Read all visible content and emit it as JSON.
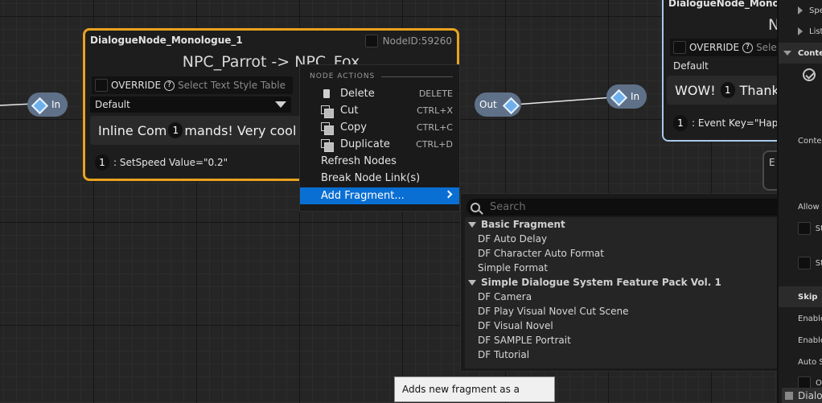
{
  "graph": {
    "left_pin_label": "In",
    "out_pin_label": "Out",
    "right_pin_label": "In"
  },
  "node1": {
    "title": "DialogueNode_Monologue_1",
    "node_id": "NodeID:59260",
    "speaker": "NPC_Parrot -> NPC_Fox",
    "override_label": "OVERRIDE",
    "style_placeholder": "Select Text Style Table",
    "style_value": "Default",
    "text_part1": "Inline Com",
    "text_badge": "1",
    "text_part2": "mands! Very cool fea",
    "event_badge": "1",
    "event_text": ": SetSpeed Value=\"0.2\""
  },
  "node2": {
    "title": "DialogueNode_Monologue",
    "speaker_fragment": "N",
    "override_label": "OVERRIDE",
    "style_placeholder": "Sele",
    "style_value": "Default",
    "text_part1": "WOW!",
    "text_badge": "1",
    "text_part2": "Thank",
    "event_badge": "1",
    "event_text": ": Event Key=\"Happ"
  },
  "node3": {
    "title_fragment": "E"
  },
  "context_menu": {
    "section_label": "NODE ACTIONS",
    "items": [
      {
        "label": "Delete",
        "shortcut": "DELETE",
        "icon": "trash-icon"
      },
      {
        "label": "Cut",
        "shortcut": "CTRL+X",
        "icon": "cut-icon"
      },
      {
        "label": "Copy",
        "shortcut": "CTRL+C",
        "icon": "copy-icon"
      },
      {
        "label": "Duplicate",
        "shortcut": "CTRL+D",
        "icon": "duplicate-icon"
      },
      {
        "label": "Refresh Nodes"
      },
      {
        "label": "Break Node Link(s)"
      },
      {
        "label": "Add Fragment..."
      }
    ]
  },
  "fragment_picker": {
    "search_placeholder": "Search",
    "categories": [
      {
        "name": "Basic Fragment",
        "items": [
          "DF Auto Delay",
          "DF Character Auto Format",
          "Simple Format"
        ]
      },
      {
        "name": "Simple Dialogue System Feature Pack Vol. 1",
        "items": [
          "DF Camera",
          "DF Play Visual Novel Cut Scene",
          "DF Visual Novel",
          "DF SAMPLE Portrait",
          "DF Tutorial"
        ]
      }
    ]
  },
  "tooltip": "Adds new fragment as a subnode",
  "details_panel": {
    "rows": [
      "Spe",
      "List",
      "Contex",
      "Contex",
      "Allow C",
      "St",
      "St",
      "Skip",
      "Enable",
      "Enable",
      "Auto S",
      "O",
      "Dialo"
    ]
  },
  "colors": {
    "selected_node_border": "#e9a21f",
    "node_border": "#a9c9ec",
    "menu_highlight": "#0a6fd3",
    "pin": "#5f7188"
  }
}
